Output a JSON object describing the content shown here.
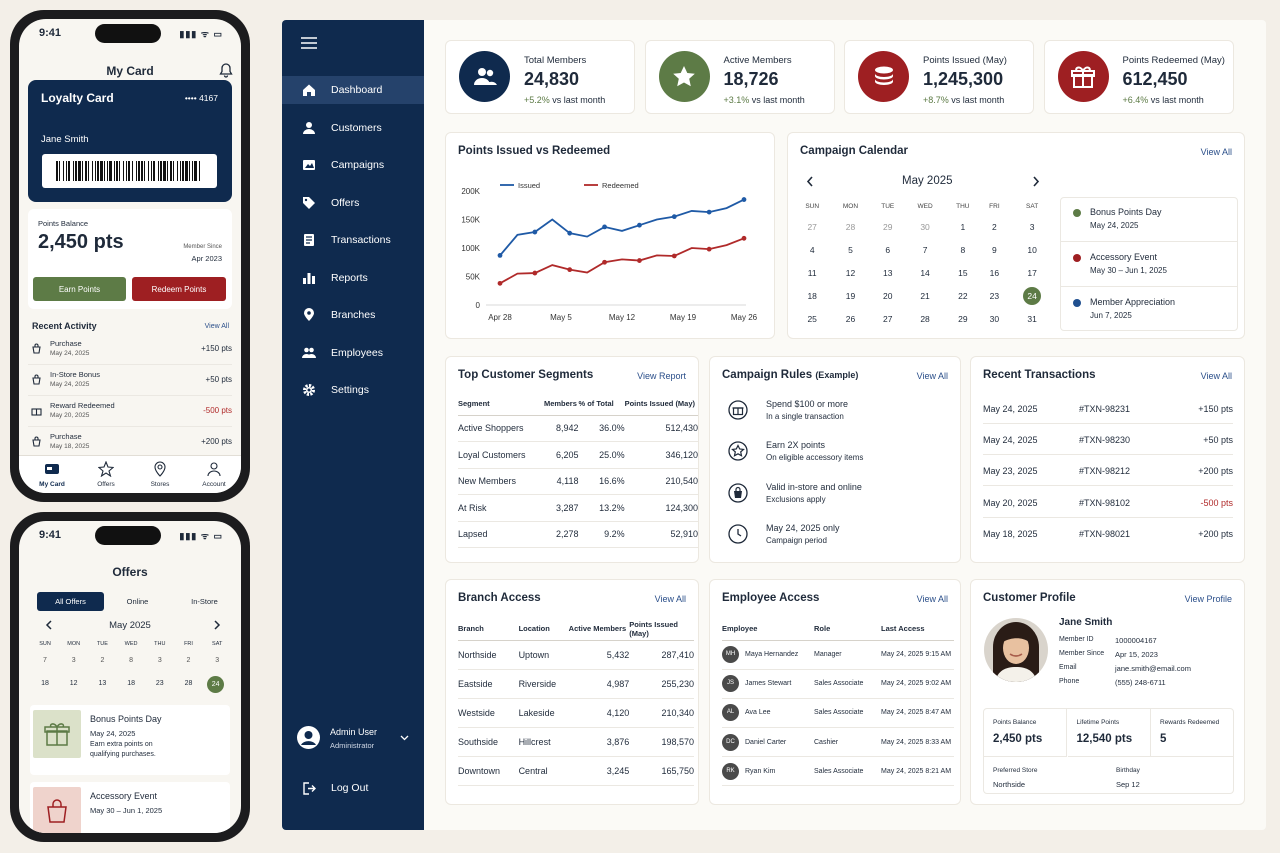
{
  "phone1": {
    "time": "9:41",
    "status_icons": "▮▮▮ ᯤ ▭",
    "title": "My Card",
    "bell_icon": "bell-icon",
    "card": {
      "title": "Loyalty Card",
      "number": "•••• 4167",
      "name": "Jane Smith"
    },
    "balance": {
      "label": "Points Balance",
      "value": "2,450 pts",
      "member_since_label": "Member Since",
      "member_since": "Apr 2023"
    },
    "earn_label": "Earn Points",
    "redeem_label": "Redeem Points",
    "recent_title": "Recent Activity",
    "view_all": "View All",
    "activity": [
      {
        "title": "Purchase",
        "date": "May 24, 2025",
        "pts": "+150 pts"
      },
      {
        "title": "In-Store Bonus",
        "date": "May 24, 2025",
        "pts": "+50 pts"
      },
      {
        "title": "Reward Redeemed",
        "date": "May 20, 2025",
        "pts": "-500 pts"
      },
      {
        "title": "Purchase",
        "date": "May 18, 2025",
        "pts": "+200 pts"
      }
    ],
    "tabs": [
      "My Card",
      "Offers",
      "Stores",
      "Account"
    ]
  },
  "phone2": {
    "time": "9:41",
    "title": "Offers",
    "filters": [
      "All Offers",
      "Online",
      "In-Store"
    ],
    "month": "May 2025",
    "days": [
      "SUN",
      "MON",
      "TUE",
      "WED",
      "THU",
      "FRI",
      "SAT"
    ],
    "week": [
      "18",
      "12",
      "13",
      "18",
      "23",
      "28",
      "24"
    ],
    "week0": [
      "7",
      "3",
      "2",
      "8",
      "3",
      "2",
      "3"
    ],
    "offers": [
      {
        "title": "Bonus Points Day",
        "date": "May 24, 2025",
        "desc1": "Earn extra points on",
        "desc2": "qualifying purchases."
      },
      {
        "title": "Accessory Event",
        "date": "May 30 – Jun 1, 2025"
      }
    ]
  },
  "sidebar": {
    "items": [
      "Dashboard",
      "Customers",
      "Campaigns",
      "Offers",
      "Transactions",
      "Reports",
      "Branches",
      "Employees",
      "Settings"
    ],
    "user_name": "Admin User",
    "user_role": "Administrator",
    "logout": "Log Out"
  },
  "stats": [
    {
      "label": "Total Members",
      "value": "24,830",
      "change": "+5.2%",
      "suffix": "vs last month",
      "color": "#0f2a4e",
      "icon": "users-icon"
    },
    {
      "label": "Active Members",
      "value": "18,726",
      "change": "+3.1%",
      "suffix": "vs last month",
      "color": "#5d7b46",
      "icon": "star-icon"
    },
    {
      "label": "Points Issued (May)",
      "value": "1,245,300",
      "change": "+8.7%",
      "suffix": "vs last month",
      "color": "#9e1f22",
      "icon": "coins-icon"
    },
    {
      "label": "Points Redeemed (May)",
      "value": "612,450",
      "change": "+6.4%",
      "suffix": "vs last month",
      "color": "#9e1f22",
      "icon": "gift-icon"
    }
  ],
  "chart_data": {
    "type": "line",
    "title": "Points Issued vs Redeemed",
    "x": [
      "Apr 28",
      "Apr 30",
      "May 2",
      "May 4",
      "May 6",
      "May 8",
      "May 10",
      "May 12",
      "May 14",
      "May 16",
      "May 18",
      "May 20",
      "May 22",
      "May 24",
      "May 26"
    ],
    "x_ticks": [
      "Apr 28",
      "May 5",
      "May 12",
      "May 19",
      "May 26"
    ],
    "y_ticks": [
      "200K",
      "150K",
      "100K",
      "50K",
      "0"
    ],
    "ylim": [
      0,
      200000
    ],
    "series": [
      {
        "name": "Issued",
        "color": "#1f5aa6",
        "values": [
          87000,
          123000,
          128000,
          150000,
          126000,
          120000,
          137000,
          130000,
          140000,
          150000,
          155000,
          165000,
          163000,
          170000,
          185000
        ]
      },
      {
        "name": "Redeemed",
        "color": "#b02a2a",
        "values": [
          38000,
          55000,
          56000,
          70000,
          62000,
          57000,
          75000,
          80000,
          78000,
          87000,
          86000,
          100000,
          98000,
          105000,
          117000
        ]
      }
    ],
    "legend": "top-left",
    "grid": true
  },
  "calendar": {
    "title": "Campaign Calendar",
    "view_all": "View All",
    "month": "May 2025",
    "days": [
      "SUN",
      "MON",
      "TUE",
      "WED",
      "THU",
      "FRI",
      "SAT"
    ],
    "weeks": [
      [
        "27",
        "28",
        "29",
        "30",
        "1",
        "2",
        "3"
      ],
      [
        "4",
        "5",
        "6",
        "7",
        "8",
        "9",
        "10"
      ],
      [
        "11",
        "12",
        "13",
        "14",
        "15",
        "16",
        "17"
      ],
      [
        "18",
        "19",
        "20",
        "21",
        "22",
        "23",
        "24"
      ],
      [
        "25",
        "26",
        "27",
        "28",
        "29",
        "30",
        "31"
      ]
    ],
    "events": [
      {
        "title": "Bonus Points Day",
        "date": "May 24, 2025",
        "color": "#5d7b46"
      },
      {
        "title": "Accessory Event",
        "date": "May 30 – Jun 1, 2025",
        "color": "#9e1f22"
      },
      {
        "title": "Member Appreciation",
        "date": "Jun 7, 2025",
        "color": "#1f4f8f"
      }
    ]
  },
  "segments": {
    "title": "Top Customer Segments",
    "link": "View Report",
    "headers": [
      "Segment",
      "Members",
      "% of Total",
      "Points Issued (May)"
    ],
    "rows": [
      [
        "Active Shoppers",
        "8,942",
        "36.0%",
        "512,430"
      ],
      [
        "Loyal Customers",
        "6,205",
        "25.0%",
        "346,120"
      ],
      [
        "New Members",
        "4,118",
        "16.6%",
        "210,540"
      ],
      [
        "At Risk",
        "3,287",
        "13.2%",
        "124,300"
      ],
      [
        "Lapsed",
        "2,278",
        "9.2%",
        "52,910"
      ]
    ]
  },
  "rules": {
    "title": "Campaign Rules",
    "subtitle": "(Example)",
    "link": "View All",
    "items": [
      {
        "title": "Spend $100 or more",
        "desc": "In a single transaction",
        "icon": "dollar-icon"
      },
      {
        "title": "Earn 2X points",
        "desc": "On eligible accessory items",
        "icon": "star-badge-icon"
      },
      {
        "title": "Valid in-store and online",
        "desc": "Exclusions apply",
        "icon": "bag-icon"
      },
      {
        "title": "May 24, 2025 only",
        "desc": "Campaign period",
        "icon": "clock-icon"
      }
    ]
  },
  "transactions": {
    "title": "Recent Transactions",
    "link": "View All",
    "rows": [
      [
        "May 24, 2025",
        "#TXN-98231",
        "+150 pts"
      ],
      [
        "May 24, 2025",
        "#TXN-98230",
        "+50 pts"
      ],
      [
        "May 23, 2025",
        "#TXN-98212",
        "+200 pts"
      ],
      [
        "May 20, 2025",
        "#TXN-98102",
        "-500 pts"
      ],
      [
        "May 18, 2025",
        "#TXN-98021",
        "+200 pts"
      ]
    ]
  },
  "branches": {
    "title": "Branch Access",
    "link": "View All",
    "headers": [
      "Branch",
      "Location",
      "Active Members",
      "Points Issued (May)"
    ],
    "rows": [
      [
        "Northside",
        "Uptown",
        "5,432",
        "287,410"
      ],
      [
        "Eastside",
        "Riverside",
        "4,987",
        "255,230"
      ],
      [
        "Westside",
        "Lakeside",
        "4,120",
        "210,340"
      ],
      [
        "Southside",
        "Hillcrest",
        "3,876",
        "198,570"
      ],
      [
        "Downtown",
        "Central",
        "3,245",
        "165,750"
      ]
    ]
  },
  "employees": {
    "title": "Employee Access",
    "link": "View All",
    "headers": [
      "Employee",
      "Role",
      "Last Access"
    ],
    "rows": [
      {
        "initials": "MH",
        "name": "Maya Hernandez",
        "role": "Manager",
        "last": "May 24, 2025 9:15 AM"
      },
      {
        "initials": "JS",
        "name": "James Stewart",
        "role": "Sales Associate",
        "last": "May 24, 2025 9:02 AM"
      },
      {
        "initials": "AL",
        "name": "Ava Lee",
        "role": "Sales Associate",
        "last": "May 24, 2025 8:47 AM"
      },
      {
        "initials": "DC",
        "name": "Daniel Carter",
        "role": "Cashier",
        "last": "May 24, 2025 8:33 AM"
      },
      {
        "initials": "RK",
        "name": "Ryan Kim",
        "role": "Sales Associate",
        "last": "May 24, 2025 8:21 AM"
      }
    ]
  },
  "profile": {
    "title": "Customer Profile",
    "link": "View Profile",
    "name": "Jane Smith",
    "fields": [
      {
        "label": "Member ID",
        "value": "1000004167"
      },
      {
        "label": "Member Since",
        "value": "Apr 15, 2023"
      },
      {
        "label": "Email",
        "value": "jane.smith@email.com"
      },
      {
        "label": "Phone",
        "value": "(555) 248-6711"
      }
    ],
    "metrics": [
      {
        "label": "Points Balance",
        "value": "2,450 pts"
      },
      {
        "label": "Lifetime Points",
        "value": "12,540 pts"
      },
      {
        "label": "Rewards Redeemed",
        "value": "5"
      }
    ],
    "store_label": "Preferred Store",
    "store": "Northside",
    "birthday_label": "Birthday",
    "birthday": "Sep 12"
  }
}
